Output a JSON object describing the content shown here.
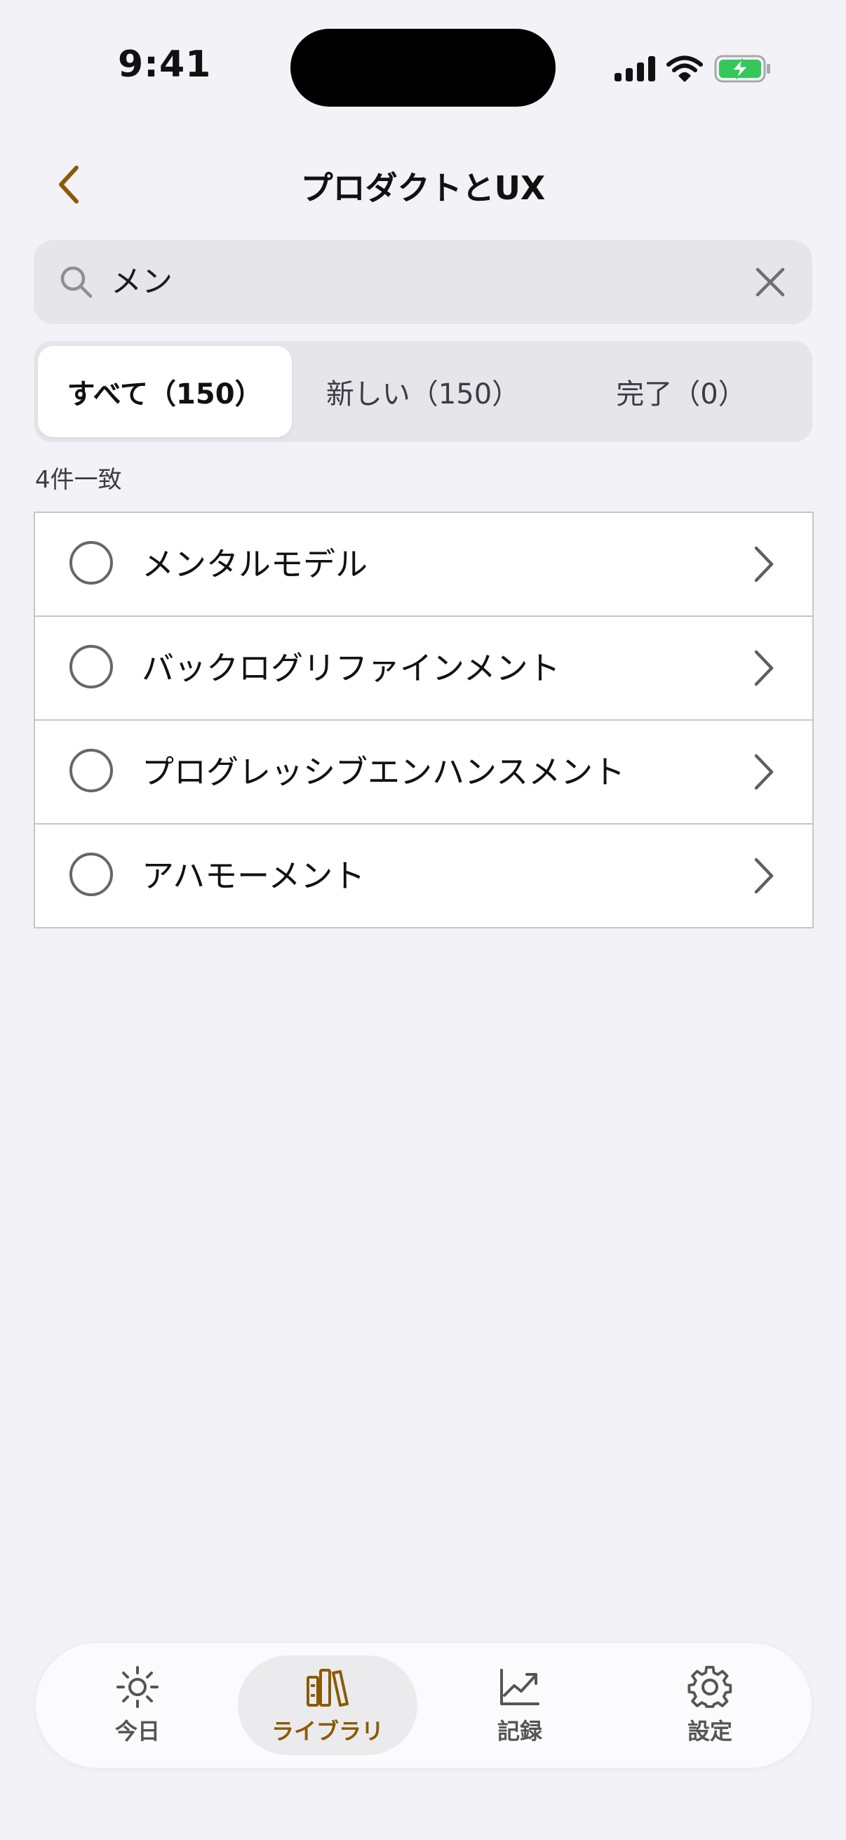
{
  "status_bar": {
    "time": "9:41"
  },
  "nav": {
    "title": "プロダクトとUX"
  },
  "search": {
    "value": "メン"
  },
  "segments": [
    {
      "label": "すべて（150）",
      "active": true
    },
    {
      "label": "新しい（150）",
      "active": false
    },
    {
      "label": "完了（0）",
      "active": false
    }
  ],
  "match_count": "4件一致",
  "items": [
    {
      "label": "メンタルモデル"
    },
    {
      "label": "バックログリファインメント"
    },
    {
      "label": "プログレッシブエンハンスメント"
    },
    {
      "label": "アハモーメント"
    }
  ],
  "tabs": [
    {
      "label": "今日",
      "icon": "sun-icon",
      "active": false
    },
    {
      "label": "ライブラリ",
      "icon": "books-icon",
      "active": true
    },
    {
      "label": "記録",
      "icon": "chart-line-icon",
      "active": false
    },
    {
      "label": "設定",
      "icon": "gear-icon",
      "active": false
    }
  ],
  "colors": {
    "accent": "#8B5A00",
    "background": "#F2F2F7",
    "battery": "#34C759"
  }
}
